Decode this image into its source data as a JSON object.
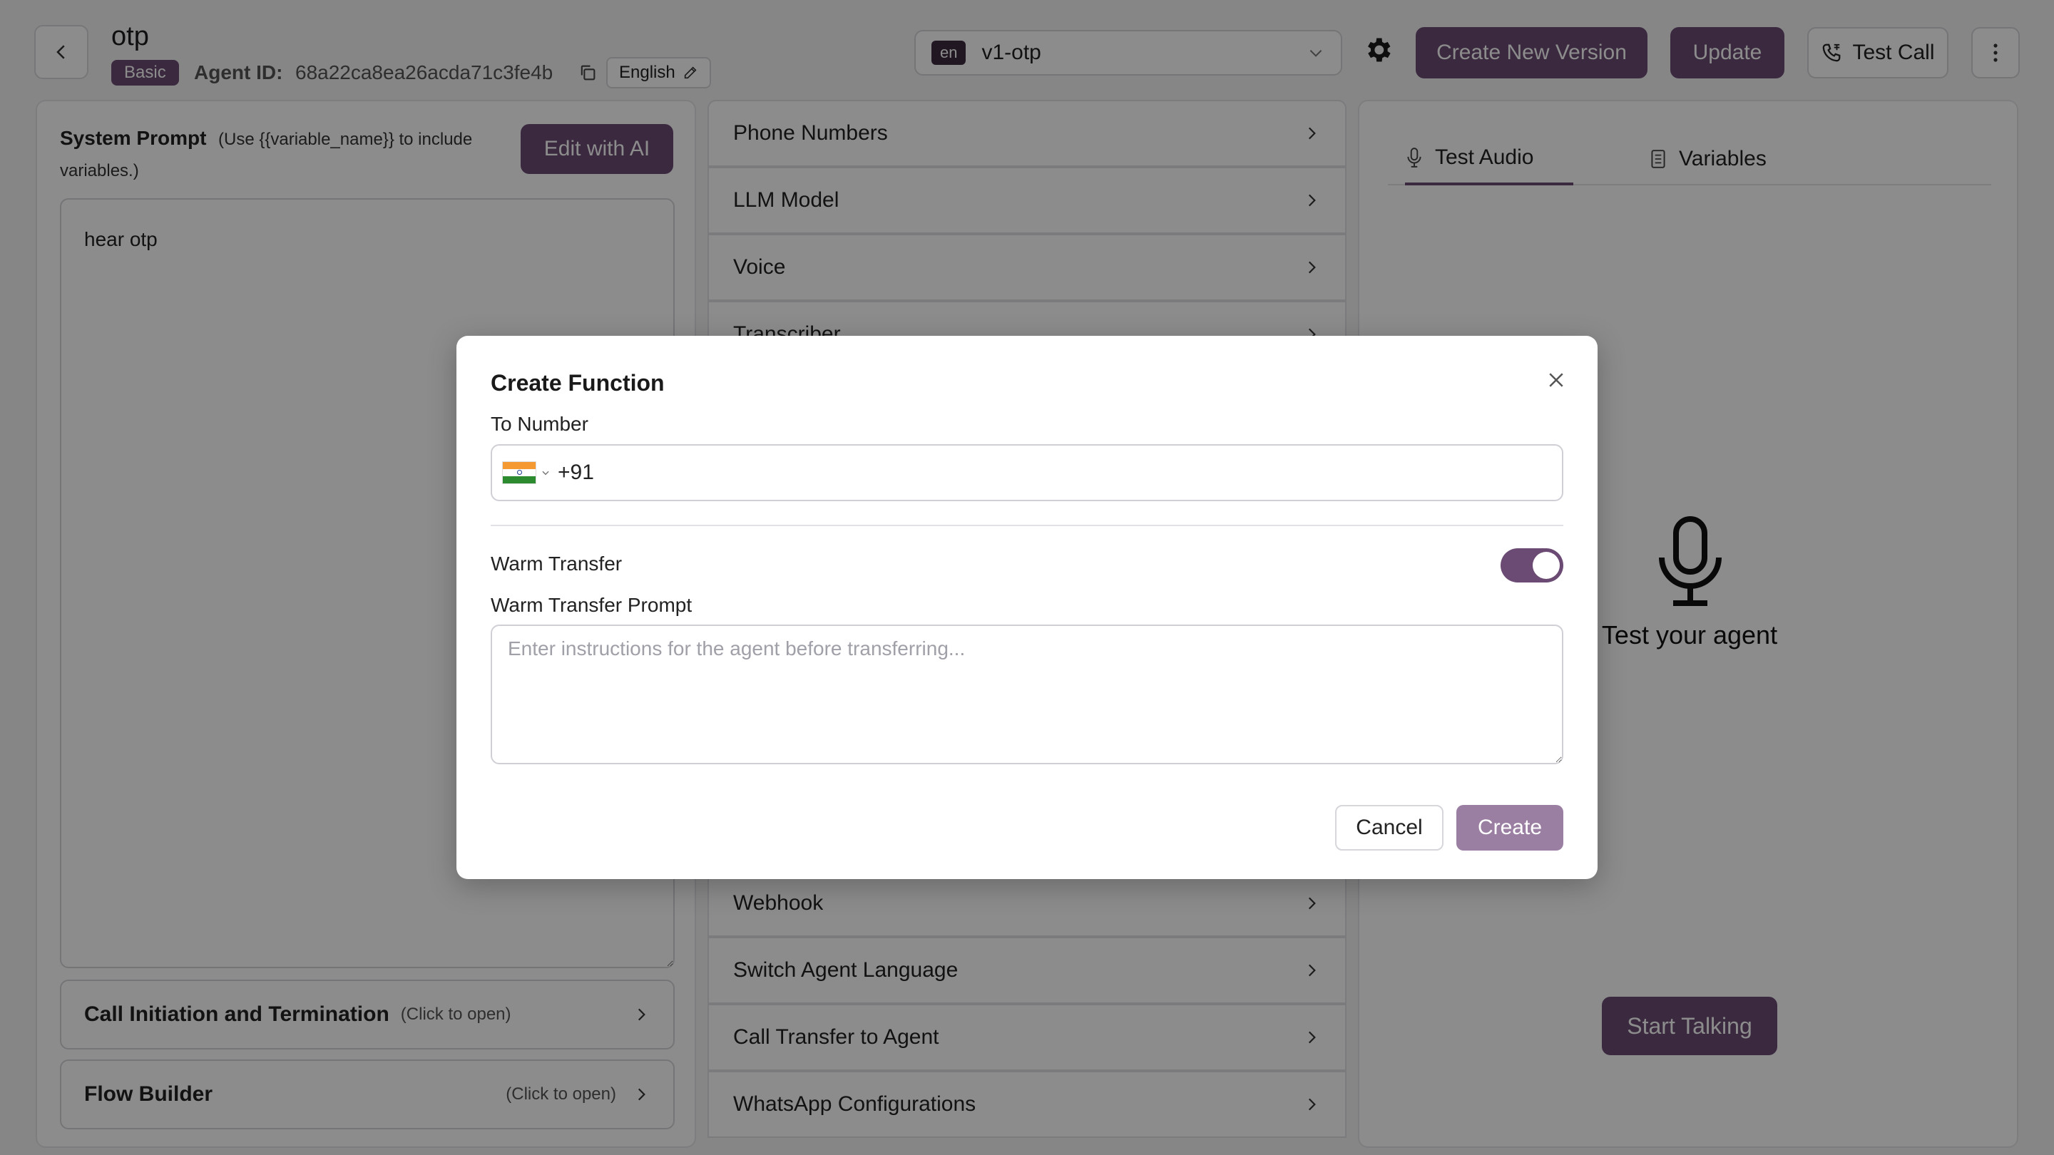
{
  "header": {
    "agent_name": "otp",
    "badge": "Basic",
    "agent_id_label": "Agent ID:",
    "agent_id_value": "68a22ca8ea26acda71c3fe4b",
    "language": "English",
    "version_lang_chip": "en",
    "version": "v1-otp",
    "create_version_label": "Create New Version",
    "update_label": "Update",
    "test_call_label": "Test Call"
  },
  "left_panel": {
    "system_prompt_title": "System Prompt",
    "system_prompt_hint_1": "(Use {{variable_name}} to include",
    "system_prompt_hint_2": "variables.)",
    "edit_ai_label": "Edit with AI",
    "prompt_text": "hear otp",
    "sections": [
      {
        "title": "Call Initiation and Termination",
        "hint": "(Click to open)"
      },
      {
        "title": "Flow Builder",
        "hint": "(Click to open)"
      }
    ]
  },
  "middle_panel": {
    "items_top": [
      "Phone Numbers",
      "LLM Model",
      "Voice",
      "Transcriber"
    ],
    "items_bottom": [
      "Webhook",
      "Switch Agent Language",
      "Call Transfer to Agent",
      "WhatsApp Configurations"
    ]
  },
  "right_panel": {
    "tab_audio": "Test Audio",
    "tab_variables": "Variables",
    "test_agent_label": "Test your agent",
    "start_talking_label": "Start Talking"
  },
  "modal": {
    "title": "Create Function",
    "to_number_label": "To Number",
    "phone_prefix": "+91",
    "warm_transfer_label": "Warm Transfer",
    "warm_transfer_enabled": true,
    "warm_prompt_label": "Warm Transfer Prompt",
    "warm_prompt_placeholder": "Enter instructions for the agent before transferring...",
    "cancel_label": "Cancel",
    "create_label": "Create"
  },
  "colors": {
    "primary": "#6b4b73",
    "primary_disabled": "#9b7fa3"
  },
  "icons": [
    "chevron-left-icon",
    "copy-icon",
    "pencil-icon",
    "chevron-down-icon",
    "gear-icon",
    "phone-icon",
    "kebab-icon",
    "chevron-right-icon",
    "mic-icon",
    "list-icon",
    "close-icon",
    "india-flag-icon"
  ]
}
